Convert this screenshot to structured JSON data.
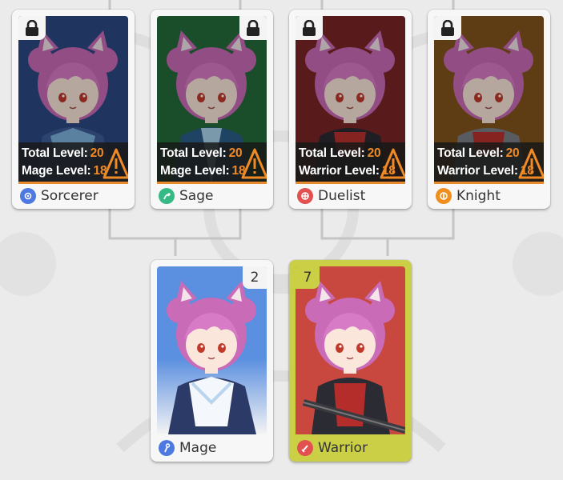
{
  "advanced_classes": [
    {
      "name": "Sorcerer",
      "req_total_label": "Total Level:",
      "req_total_value": "20",
      "req_class_label": "Mage Level:",
      "req_class_value": "18",
      "bg": "#2b4a86",
      "icon_color": "#4e79e0",
      "locked": true
    },
    {
      "name": "Sage",
      "req_total_label": "Total Level:",
      "req_total_value": "20",
      "req_class_label": "Mage Level:",
      "req_class_value": "18",
      "bg": "#256b3a",
      "icon_color": "#35b985",
      "locked": true
    },
    {
      "name": "Duelist",
      "req_total_label": "Total Level:",
      "req_total_value": "20",
      "req_class_label": "Warrior Level:",
      "req_class_value": "18",
      "bg": "#7a2424",
      "icon_color": "#e25050",
      "locked": true
    },
    {
      "name": "Knight",
      "req_total_label": "Total Level:",
      "req_total_value": "20",
      "req_class_label": "Warrior Level:",
      "req_class_value": "18",
      "bg": "#83551d",
      "icon_color": "#ef8f1e",
      "locked": true
    }
  ],
  "base_classes": [
    {
      "name": "Mage",
      "count": "2",
      "bg": "#5b8fe0",
      "icon_color": "#4e79e0",
      "selected": false
    },
    {
      "name": "Warrior",
      "count": "7",
      "bg": "#c8473f",
      "icon_color": "#e25050",
      "selected": true
    }
  ],
  "colors": {
    "accent": "#f08a24",
    "selected": "#cbcf45",
    "background": "#ebebeb"
  },
  "icons": {
    "lock": "lock-icon",
    "warning": "warning-triangle-icon"
  }
}
